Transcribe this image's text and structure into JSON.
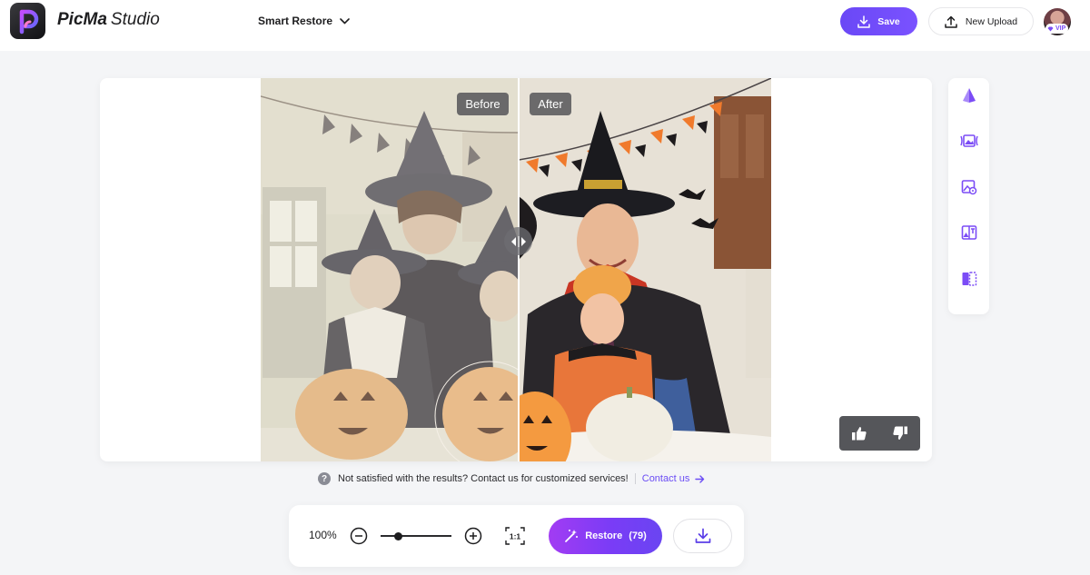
{
  "app": {
    "brand": "PicMa",
    "suffix": "Studio"
  },
  "header": {
    "mode_label": "Smart Restore",
    "save_label": "Save",
    "upload_label": "New Upload",
    "vip_label": "VIP"
  },
  "canvas": {
    "before_label": "Before",
    "after_label": "After",
    "tool_icons": [
      "prism-icon",
      "image-enhance-icon",
      "image-settings-icon",
      "color-swap-icon",
      "compare-split-icon"
    ]
  },
  "feedback": {
    "help_glyph": "?",
    "message": "Not satisfied with the results? Contact us for customized services!",
    "contact_label": "Contact us"
  },
  "toolbar": {
    "zoom_value": "100%",
    "zoom_level": 0.25,
    "actual_size_label": "1:1",
    "restore_label": "Restore",
    "restore_count": "(79)"
  },
  "colors": {
    "accent": "#6a48f6",
    "restore_gradient_start": "#a23cf3",
    "restore_gradient_end": "#6a45f2"
  }
}
